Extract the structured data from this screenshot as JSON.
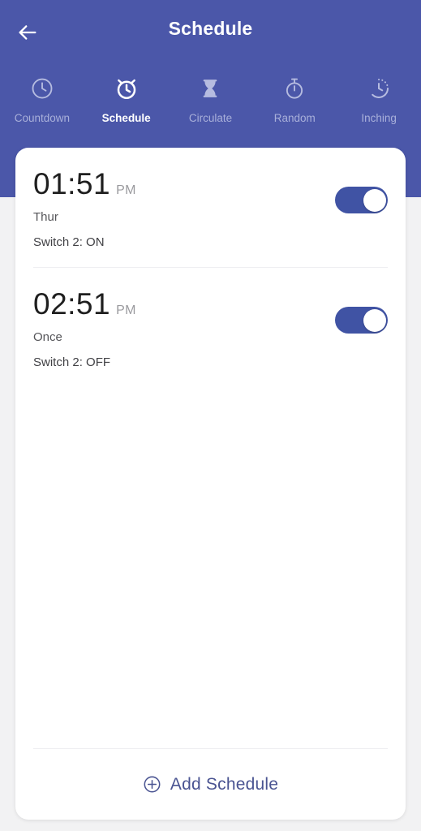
{
  "header": {
    "title": "Schedule",
    "back_icon": "arrow-left-icon",
    "background_color": "#4b57a9"
  },
  "tabs": [
    {
      "label": "Countdown",
      "icon": "clock-icon",
      "active": false
    },
    {
      "label": "Schedule",
      "icon": "alarm-clock-icon",
      "active": true
    },
    {
      "label": "Circulate",
      "icon": "hourglass-icon",
      "active": false
    },
    {
      "label": "Random",
      "icon": "stopwatch-icon",
      "active": false
    },
    {
      "label": "Inching",
      "icon": "timer-dotted-icon",
      "active": false
    }
  ],
  "schedules": [
    {
      "time": "01:51",
      "meridiem": "PM",
      "repeat": "Thur",
      "action": "Switch 2: ON",
      "enabled": true,
      "toggle_state": "on"
    },
    {
      "time": "02:51",
      "meridiem": "PM",
      "repeat": "Once",
      "action": "Switch 2: OFF",
      "enabled": true,
      "toggle_state": "on"
    }
  ],
  "footer": {
    "add_label": "Add Schedule",
    "add_icon": "plus-circle-icon"
  },
  "colors": {
    "accent": "#4b57a9",
    "toggle_on": "#4053a4",
    "add_text": "#4a5492",
    "card": "#ffffff"
  }
}
